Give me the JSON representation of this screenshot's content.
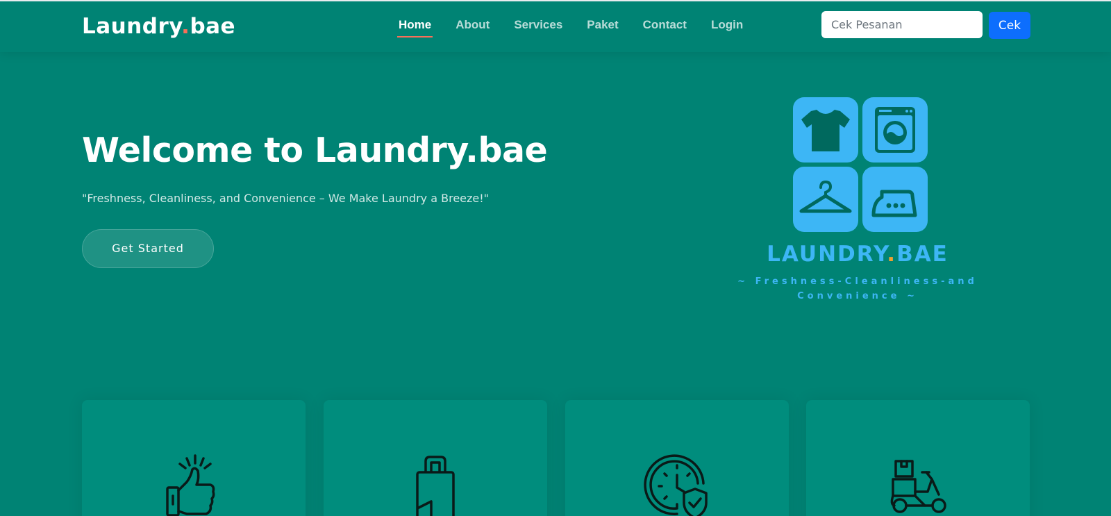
{
  "header": {
    "logo_text": "Laundry",
    "logo_dot": ".",
    "logo_suffix": "bae",
    "nav": [
      {
        "label": "Home",
        "active": true
      },
      {
        "label": "About",
        "active": false
      },
      {
        "label": "Services",
        "active": false
      },
      {
        "label": "Paket",
        "active": false
      },
      {
        "label": "Contact",
        "active": false
      },
      {
        "label": "Login",
        "active": false
      }
    ],
    "search": {
      "placeholder": "Cek Pesanan",
      "value": ""
    },
    "search_button": "Cek"
  },
  "hero": {
    "title": "Welcome to Laundry.bae",
    "subtitle": "\"Freshness, Cleanliness, and Convenience – We Make Laundry a Breeze!\"",
    "cta": "Get Started"
  },
  "brand": {
    "name_part1": "LAUNDRY",
    "name_dot": ".",
    "name_part2": "BAE",
    "tagline_line1": "~ Freshness-Cleanliness-and",
    "tagline_line2": "Convenience ~",
    "tiles": [
      "tshirt-icon",
      "washing-machine-icon",
      "hanger-icon",
      "iron-icon"
    ]
  },
  "features": [
    {
      "icon": "thumbs-up-icon"
    },
    {
      "icon": "laundry-bag-icon"
    },
    {
      "icon": "clock-shield-icon"
    },
    {
      "icon": "delivery-scooter-icon"
    }
  ],
  "colors": {
    "background": "#008374",
    "accent": "#f96f59",
    "brand_blue": "#3db6f5",
    "button_blue": "#0d6efd",
    "card": "#008d7d"
  }
}
